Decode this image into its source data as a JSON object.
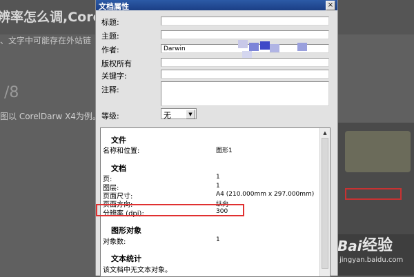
{
  "background": {
    "title": "辨率怎么调,Core",
    "subtitle": "、文字中可能存在外站链",
    "step": "/8",
    "intro": "图以 CorelDarw X4为例。",
    "watermark": {
      "brand": "经验",
      "url": "jingyan.baidu.com"
    }
  },
  "dialog": {
    "title": "文档属性",
    "close_label": "×",
    "fields": [
      {
        "label": "标题:",
        "value": ""
      },
      {
        "label": "主题:",
        "value": ""
      },
      {
        "label": "作者:",
        "value": "Darwin"
      },
      {
        "label": "版权所有",
        "value": ""
      },
      {
        "label": "关键字:",
        "value": ""
      }
    ],
    "notes_label": "注释:",
    "grade_label": "等级:",
    "grade_value": "无",
    "info": {
      "sections": [
        {
          "title": "文件",
          "rows": [
            {
              "label": "名称和位置:",
              "value": "图形1"
            }
          ]
        },
        {
          "title": "文档",
          "rows": [
            {
              "label": "页:",
              "value": "1"
            },
            {
              "label": "图层:",
              "value": "1"
            },
            {
              "label": "页面尺寸:",
              "value": "A4 (210.000mm x 297.000mm)"
            },
            {
              "label": "页面方向:",
              "value": "纵向"
            },
            {
              "label": "分辨率 (dpi):",
              "value": "300"
            }
          ]
        },
        {
          "title": "图形对象",
          "rows": [
            {
              "label": "对象数:",
              "value": "1"
            }
          ]
        },
        {
          "title": "文本统计",
          "rows": [
            {
              "label": "该文档中无文本对象。",
              "value": ""
            }
          ]
        }
      ]
    }
  },
  "colors": {
    "titlebar": "#1b3f86",
    "highlight": "#e03030",
    "blur": [
      "#c8c8e8",
      "#7d85d8",
      "#3e48c8",
      "#b0b4e4"
    ]
  }
}
